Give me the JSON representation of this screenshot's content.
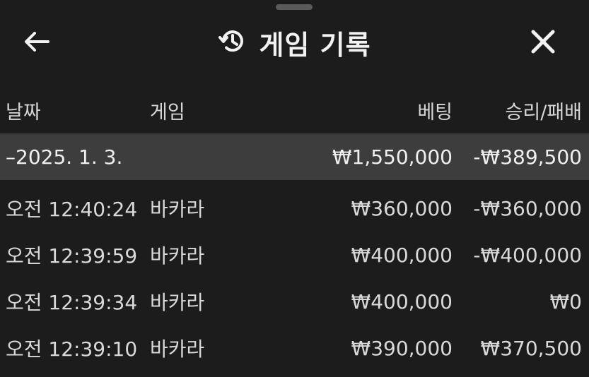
{
  "header": {
    "title": "게임 기록",
    "back_icon": "arrow-left-icon",
    "history_icon": "history-icon",
    "close_icon": "close-icon"
  },
  "columns": {
    "date": "날짜",
    "game": "게임",
    "bet": "베팅",
    "result": "승리/패배"
  },
  "group": {
    "label": "–2025. 1. 3.",
    "bet": "₩1,550,000",
    "result": "-₩389,500"
  },
  "rows": [
    {
      "time": "오전 12:40:24",
      "game": "바카라",
      "bet": "₩360,000",
      "result": "-₩360,000"
    },
    {
      "time": "오전 12:39:59",
      "game": "바카라",
      "bet": "₩400,000",
      "result": "-₩400,000"
    },
    {
      "time": "오전 12:39:34",
      "game": "바카라",
      "bet": "₩400,000",
      "result": "₩0"
    },
    {
      "time": "오전 12:39:10",
      "game": "바카라",
      "bet": "₩390,000",
      "result": "₩370,500"
    }
  ],
  "colors": {
    "background": "#1c1c1c",
    "group_row": "#3d3d3d",
    "text": "#d9d9d9"
  }
}
